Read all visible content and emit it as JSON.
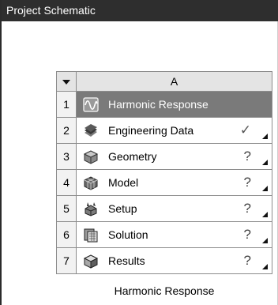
{
  "title": "Project Schematic",
  "system": {
    "column_header": "A",
    "caption": "Harmonic Response",
    "rows": [
      {
        "num": "1",
        "label": "Harmonic Response",
        "icon": "harmonic-response-icon",
        "status": ""
      },
      {
        "num": "2",
        "label": "Engineering Data",
        "icon": "engineering-data-icon",
        "status": "✓"
      },
      {
        "num": "3",
        "label": "Geometry",
        "icon": "geometry-icon",
        "status": "?"
      },
      {
        "num": "4",
        "label": "Model",
        "icon": "model-icon",
        "status": "?"
      },
      {
        "num": "5",
        "label": "Setup",
        "icon": "setup-icon",
        "status": "?"
      },
      {
        "num": "6",
        "label": "Solution",
        "icon": "solution-icon",
        "status": "?"
      },
      {
        "num": "7",
        "label": "Results",
        "icon": "results-icon",
        "status": "?"
      }
    ]
  },
  "colors": {
    "titlebar": "#2e2e2e",
    "selected_row": "#7a7a7a",
    "grid_line": "#8c8c8c"
  }
}
